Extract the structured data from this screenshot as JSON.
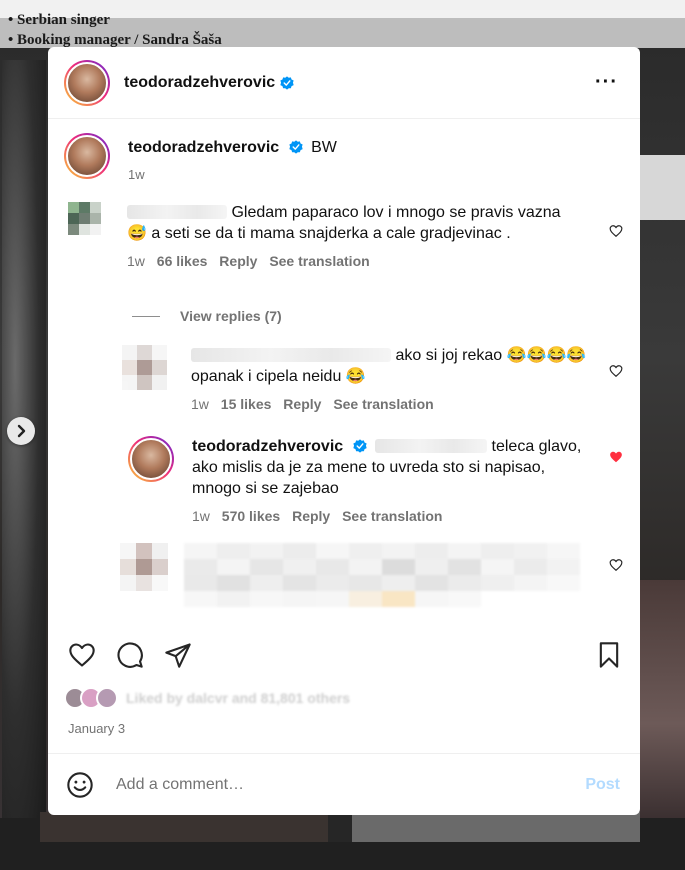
{
  "background": {
    "line1": "• Serbian singer",
    "line2": "• Booking manager / Sandra Šaša"
  },
  "post": {
    "username": "teodoradzehverovic",
    "more_label": "···",
    "caption_text": "BW",
    "caption_age": "1w"
  },
  "comments": [
    {
      "text": "Gledam paparaco lov i mnogo se pravis vazna",
      "text2": "a seti se da ti mama snajderka a cale gradjevinac .",
      "emoji": "😅",
      "age": "1w",
      "likes": "66 likes",
      "reply": "Reply",
      "translate": "See translation"
    },
    {
      "text": "ako si joj rekao",
      "emoji": "😂😂😂😂",
      "text2": "opanak i cipela neidu",
      "emoji2": "😂",
      "age": "1w",
      "likes": "15 likes",
      "reply": "Reply",
      "translate": "See translation"
    },
    {
      "username": "teodoradzehverovic",
      "text": "teleca glavo,",
      "text2": "ako mislis da je za mene to uvreda sto si napisao,",
      "text3": "mnogo si se zajebao",
      "age": "1w",
      "likes": "570 likes",
      "reply": "Reply",
      "translate": "See translation",
      "liked": true
    }
  ],
  "view_replies": "View replies (7)",
  "likes_summary": "Liked by dalcvr and 81,801 others",
  "date": "January 3",
  "composer": {
    "placeholder": "Add a comment…",
    "post_label": "Post"
  },
  "colors": {
    "accent_blue": "#0095f6",
    "heart_red": "#ff3040",
    "post_disabled": "#b3dbff"
  },
  "icons": [
    "more-icon",
    "verified-icon",
    "heart-icon",
    "comment-icon",
    "share-icon",
    "bookmark-icon",
    "emoji-icon",
    "chevron-right-icon"
  ]
}
